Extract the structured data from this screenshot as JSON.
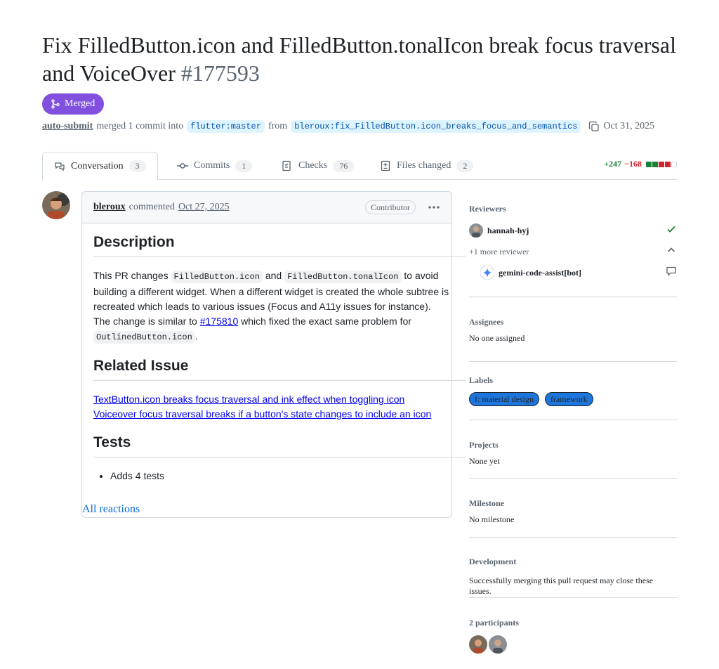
{
  "pr": {
    "title": "Fix FilledButton.icon and FilledButton.tonalIcon break focus traversal and VoiceOver",
    "number": "#177593",
    "state": "Merged",
    "author": "auto-submit",
    "merge_text": "merged 1 commit into",
    "base_branch": "flutter:master",
    "from_text": "from",
    "head_branch": "bleroux:fix_FilledButton.icon_breaks_focus_and_semantics",
    "date": "Oct 31, 2025"
  },
  "tabs": [
    {
      "label": "Conversation",
      "count": "3"
    },
    {
      "label": "Commits",
      "count": "1"
    },
    {
      "label": "Checks",
      "count": "76"
    },
    {
      "label": "Files changed",
      "count": "2"
    }
  ],
  "diffstat": {
    "additions": "+247",
    "deletions": "−168"
  },
  "comment": {
    "user": "bleroux",
    "action": "commented",
    "date": "Oct 27, 2025",
    "role": "Contributor",
    "heading_description": "Description",
    "desc_1": "This PR changes",
    "code_1": "FilledButton.icon",
    "desc_2": "and",
    "code_2": "FilledButton.tonalIcon",
    "desc_3": "to avoid building a different widget. When a different widget is created the whole subtree is recreated which leads to various issues (Focus and A11y issues for instance).",
    "desc_4": "The change is similar to",
    "link_pr": "#175810",
    "desc_5": "which fixed the exact same problem for",
    "code_3": "OutlinedButton.icon",
    "desc_6": ".",
    "heading_related": "Related Issue",
    "issue_1": "TextButton.icon breaks focus traversal and ink effect when toggling icon",
    "issue_2": "Voiceover focus traversal breaks if a button's state changes to include an icon",
    "heading_tests": "Tests",
    "test_1": "Adds 4 tests",
    "reactions": "All reactions"
  },
  "sidebar": {
    "reviewers_title": "Reviewers",
    "reviewer_1": "hannah-hyj",
    "more_reviewers": "+1 more reviewer",
    "reviewer_2": "gemini-code-assist[bot]",
    "assignees_title": "Assignees",
    "assignees_value": "No one assigned",
    "labels_title": "Labels",
    "labels": [
      "f: material design",
      "framework"
    ],
    "label_color": "#1d76db",
    "projects_title": "Projects",
    "projects_value": "None yet",
    "milestone_title": "Milestone",
    "milestone_value": "No milestone",
    "development_title": "Development",
    "development_value": "Successfully merging this pull request may close these issues.",
    "participants_title": "2 participants"
  },
  "colors": {
    "merged": "#8250df",
    "link": "#0969da",
    "addition": "#1a7f37",
    "deletion": "#d1242f"
  }
}
